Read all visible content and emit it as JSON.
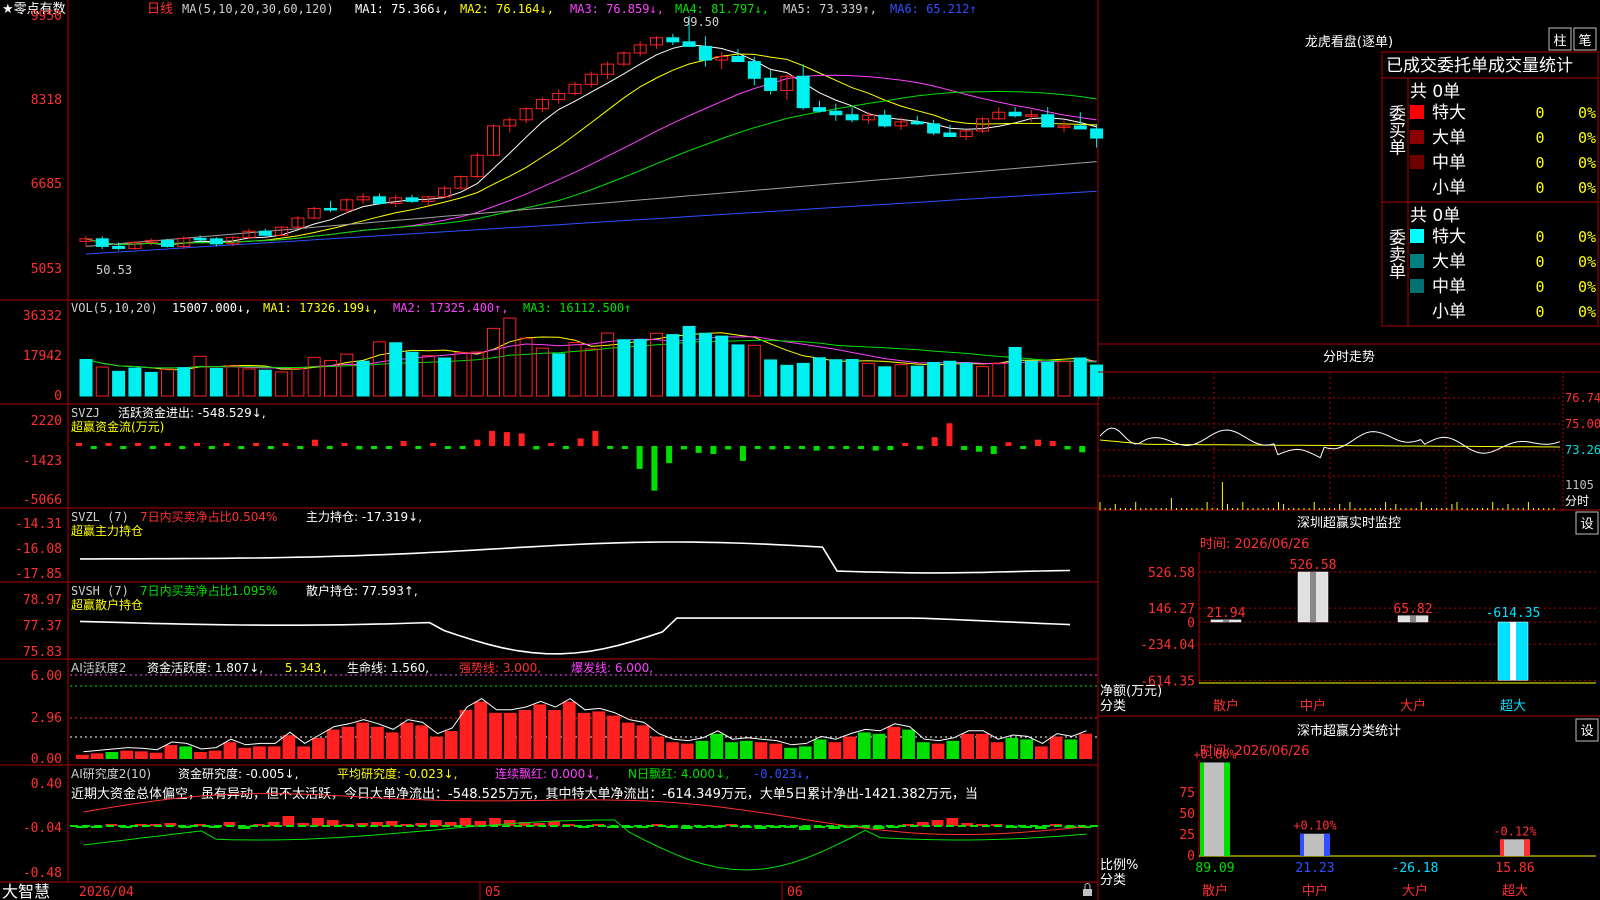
{
  "footer": {
    "brand": "大智慧",
    "start_date": "2026/04",
    "month_05": "05",
    "month_06": "06"
  },
  "colors": {
    "up": "#ff2020",
    "down": "#00f0f0",
    "green": "#00e000",
    "axis": "#b00000",
    "bg": "#000000"
  },
  "main": {
    "title_star": "★零点有数",
    "period": "日线",
    "ma_header": "MA(5,10,20,30,60,120)",
    "ma1": "MA1: 75.366↓,",
    "ma2": "MA2: 76.164↓,",
    "ma3": "MA3: 76.859↓,",
    "ma4": "MA4: 81.797↓,",
    "ma5": "MA5: 73.339↑,",
    "ma6": "MA6: 65.212↑",
    "yticks": [
      "9950",
      "8318",
      "6685",
      "5053"
    ],
    "high_label": "99.50",
    "low_label": "50.53"
  },
  "vol": {
    "header": "VOL(5,10,20)",
    "value": "15007.000↓,",
    "ma1": "MA1: 17326.199↓,",
    "ma2": "MA2: 17325.400↑,",
    "ma3": "MA3: 16112.500↑",
    "yticks": [
      "36332",
      "17942",
      "0"
    ]
  },
  "svzj": {
    "header": "SVZJ",
    "label": "活跃资金进出: -548.529↓,",
    "sub": "超赢资金流(万元)",
    "yticks": [
      "2220",
      "-1423",
      "-5066"
    ]
  },
  "svzl": {
    "header": "SVZL  (7)",
    "pct": "7日内买卖净占比0.504%",
    "label": "主力持仓: -17.319↓,",
    "sub": "超赢主力持仓",
    "yticks": [
      "-14.31",
      "-16.08",
      "-17.85"
    ]
  },
  "svsh": {
    "header": "SVSH  (7)",
    "pct": "7日内买卖净占比1.095%",
    "label": "散户持仓: 77.593↑,",
    "sub": "超赢散户持仓",
    "yticks": [
      "78.97",
      "77.37",
      "75.83"
    ]
  },
  "ai1": {
    "header": "AI活跃度2",
    "l1": "资金活跃度: 1.807↓,",
    "l2": "5.343,",
    "l3": "生命线: 1.560,",
    "l4": "强势线: 3.000,",
    "l5": "爆发线: 6.000,",
    "yticks": [
      "6.00",
      "2.96",
      "0.00"
    ]
  },
  "ai2": {
    "header": "AI研究度2(10)",
    "l1": "资金研究度: -0.005↓,",
    "l2": "平均研究度: -0.023↓,",
    "l3": "连续飘红: 0.000↓,",
    "l4": "N日飘红: 4.000↓,",
    "l5": "-0.023↓,",
    "text": "近期大资金总体偏空，虽有异动，但不太活跃，今日大单净流出：-548.525万元，其中特大单净流出：-614.349万元，大单5日累计净出-1421.382万元，当",
    "yticks": [
      "0.40",
      "-0.04",
      "-0.48"
    ]
  },
  "dragon": {
    "title": "龙虎看盘(逐单)",
    "btn_bar": "柱",
    "btn_pen": "笔",
    "header": "已成交委托单成交量统计",
    "buy_label": "委买单",
    "sell_label": "委卖单",
    "buy_total": "共 0单",
    "sell_total": "共 0单",
    "rows": [
      "特大",
      "大单",
      "中单",
      "小单"
    ],
    "count": "0",
    "pct": "0%"
  },
  "intraday": {
    "title": "分时走势",
    "yticks": [
      "76.74",
      "75.00",
      "73.26"
    ],
    "vol_tick": "1105",
    "vol_label": "分时"
  },
  "sz_monitor": {
    "title": "深圳超赢实时监控",
    "btn": "设",
    "time": "时间: 2026/06/26",
    "yticks": [
      "526.58",
      "146.27",
      "0",
      "-234.04",
      "-614.35"
    ],
    "ylabel": "净额(万元)",
    "xlabel": "分类"
  },
  "sz_class": {
    "title": "深市超赢分类统计",
    "btn": "设",
    "time": "时间: 2026/06/26",
    "yticks": [
      "75",
      "50",
      "25",
      "0"
    ],
    "ylabel": "比例%",
    "xlabel": "分类"
  },
  "chart_data": [
    {
      "type": "candlestick",
      "title": "零点有数 日线",
      "ylim": [
        50.53,
        99.5
      ],
      "ma_labels": [
        "MA1",
        "MA2",
        "MA3",
        "MA4",
        "MA5",
        "MA6"
      ],
      "ohlc": [
        [
          55,
          56,
          54,
          55.5
        ],
        [
          55.5,
          56,
          53.5,
          54
        ],
        [
          54,
          54.8,
          53.2,
          53.6
        ],
        [
          53.6,
          55,
          53.4,
          54.8
        ],
        [
          54.8,
          55.6,
          54.2,
          55.2
        ],
        [
          55.2,
          55.5,
          53.8,
          54
        ],
        [
          54,
          56,
          53.5,
          55.6
        ],
        [
          55.6,
          56.2,
          54.8,
          55.5
        ],
        [
          55.5,
          55.8,
          54,
          54.5
        ],
        [
          54.5,
          56,
          54,
          55.8
        ],
        [
          55.8,
          57.5,
          55.5,
          57
        ],
        [
          57,
          57.5,
          56,
          56.2
        ],
        [
          56.2,
          58,
          56,
          57.8
        ],
        [
          57.8,
          60,
          57.5,
          59.6
        ],
        [
          59.6,
          61.8,
          59.4,
          61.5
        ],
        [
          61.5,
          63,
          60.8,
          61.2
        ],
        [
          61.2,
          63.5,
          60.5,
          63.2
        ],
        [
          63.2,
          64.5,
          62.4,
          63.8
        ],
        [
          63.8,
          64.5,
          62.2,
          62.5
        ],
        [
          62.5,
          64.2,
          61.8,
          63.6
        ],
        [
          63.6,
          64.2,
          62.6,
          62.9
        ],
        [
          62.9,
          64,
          62,
          63.8
        ],
        [
          63.8,
          66,
          63.5,
          65.5
        ],
        [
          65.5,
          68,
          65.2,
          67.8
        ],
        [
          67.8,
          72.5,
          67.5,
          72
        ],
        [
          72,
          78,
          71.8,
          77.8
        ],
        [
          77.8,
          79.5,
          76.5,
          79
        ],
        [
          79,
          81.5,
          78.4,
          81.2
        ],
        [
          81.2,
          83.5,
          80.5,
          83
        ],
        [
          83,
          85,
          82.2,
          84.2
        ],
        [
          84.2,
          86.5,
          83.8,
          86
        ],
        [
          86,
          88.5,
          85.4,
          88
        ],
        [
          88,
          90.5,
          87,
          90
        ],
        [
          90,
          92.5,
          89.5,
          92.2
        ],
        [
          92.2,
          94.5,
          91.5,
          93.8
        ],
        [
          93.8,
          95.5,
          93,
          95.2
        ],
        [
          95.2,
          96,
          93.8,
          94.4
        ],
        [
          94.4,
          99.5,
          94,
          93.5
        ],
        [
          93.5,
          95.5,
          89.5,
          90.8
        ],
        [
          90.8,
          92.4,
          89,
          91.5
        ],
        [
          91.5,
          93,
          90.5,
          90.5
        ],
        [
          90.5,
          91.5,
          85.8,
          87.2
        ],
        [
          87.2,
          88.8,
          84,
          84.8
        ],
        [
          84.8,
          88,
          83,
          87.6
        ],
        [
          87.6,
          90,
          81,
          81.4
        ],
        [
          81.4,
          82.8,
          80.4,
          80.7
        ],
        [
          80.7,
          82.2,
          78.8,
          80
        ],
        [
          80,
          81.5,
          78.5,
          79
        ],
        [
          79,
          80.5,
          78.2,
          79.9
        ],
        [
          79.9,
          81,
          77.5,
          77.8
        ],
        [
          77.8,
          79.5,
          77,
          78.6
        ],
        [
          78.6,
          79.8,
          78,
          78.2
        ],
        [
          78.2,
          79,
          76,
          76.4
        ],
        [
          76.4,
          78,
          75.6,
          75.7
        ],
        [
          75.7,
          77,
          75,
          76.8
        ],
        [
          76.8,
          79.5,
          76.4,
          79.2
        ],
        [
          79.2,
          81.5,
          79,
          80.5
        ],
        [
          80.5,
          81.5,
          79.5,
          79.8
        ],
        [
          79.8,
          81,
          78.6,
          80
        ],
        [
          80,
          81.5,
          77.5,
          77.6
        ],
        [
          77.6,
          78.8,
          76.5,
          77.8
        ],
        [
          77.8,
          80.5,
          77.5,
          77.2
        ],
        [
          77.2,
          78.2,
          73.5,
          75.4
        ]
      ]
    },
    {
      "type": "bar",
      "title": "VOL(5,10,20)",
      "ylim": [
        0,
        36332
      ],
      "values": [
        17000,
        13500,
        11500,
        13000,
        11000,
        12500,
        13200,
        18500,
        12800,
        14000,
        12600,
        12000,
        11200,
        12800,
        18000,
        16500,
        19500,
        16200,
        25200,
        24800,
        20400,
        18800,
        17700,
        20300,
        20500,
        31500,
        36300,
        26900,
        22300,
        19600,
        24900,
        21900,
        29300,
        26200,
        26300,
        29200,
        28600,
        32400,
        29200,
        27900,
        23800,
        23600,
        16800,
        14300,
        15200,
        17800,
        16900,
        17000,
        15200,
        13600,
        14600,
        13900,
        15600,
        16200,
        15300,
        13700,
        15300,
        22600,
        16200,
        15800,
        16000,
        17700,
        14400
      ],
      "up": [
        false,
        true,
        false,
        false,
        false,
        true,
        false,
        true,
        false,
        true,
        true,
        false,
        true,
        true,
        true,
        true,
        true,
        false,
        true,
        false,
        false,
        true,
        false,
        true,
        true,
        true,
        true,
        true,
        true,
        false,
        true,
        true,
        true,
        false,
        false,
        true,
        false,
        false,
        false,
        false,
        false,
        true,
        false,
        false,
        false,
        false,
        false,
        false,
        true,
        false,
        true,
        false,
        false,
        false,
        false,
        true,
        true,
        false,
        false,
        false,
        true,
        false,
        false
      ]
    },
    {
      "type": "bar",
      "title": "SVZJ 活跃资金进出",
      "ylim": [
        -5066,
        2220
      ],
      "values": [
        150,
        -80,
        120,
        -60,
        90,
        -70,
        40,
        -60,
        30,
        -40,
        80,
        -100,
        110,
        -50,
        60,
        -90,
        500,
        -80,
        120,
        -300,
        -200,
        -150,
        400,
        -120,
        80,
        -90,
        -150,
        500,
        1200,
        1100,
        1000,
        -300,
        200,
        -150,
        600,
        1200,
        -180,
        -130,
        -2000,
        -3900,
        -1500,
        -300,
        -600,
        -700,
        -300,
        -1300,
        -250,
        -300,
        -180,
        -250,
        -400,
        -150,
        -100,
        -260,
        -400,
        -350,
        200,
        -300,
        700,
        1800,
        -350,
        -500,
        -700,
        300,
        -150,
        500,
        400,
        -300,
        -548.5
      ]
    },
    {
      "type": "line",
      "title": "SVZL 主力持仓",
      "ylim": [
        -17.85,
        -14.31
      ]
    },
    {
      "type": "line",
      "title": "SVSH 散户持仓",
      "ylim": [
        75.83,
        78.97
      ]
    },
    {
      "type": "bar",
      "title": "AI活跃度2 资金活跃度",
      "ylim": [
        0,
        6
      ],
      "reference_lines": {
        "生命线": 1.56,
        "强势线": 3.0,
        "爆发线": 6.0
      },
      "values": [
        0.3,
        0.4,
        0.5,
        0.6,
        0.55,
        0.45,
        1.0,
        0.9,
        0.5,
        0.6,
        1.2,
        0.8,
        0.9,
        0.9,
        1.7,
        0.9,
        1.5,
        2.1,
        2.3,
        2.6,
        2.3,
        1.9,
        2.6,
        2.4,
        1.6,
        2.0,
        3.5,
        4.1,
        3.3,
        3.3,
        3.5,
        3.9,
        3.5,
        4.1,
        3.3,
        3.4,
        3.1,
        2.6,
        2.4,
        1.6,
        1.2,
        1.1,
        1.3,
        1.8,
        1.2,
        1.3,
        1.2,
        1.1,
        0.8,
        0.9,
        1.4,
        1.2,
        1.6,
        1.9,
        1.8,
        2.3,
        2.1,
        1.2,
        1.1,
        1.3,
        1.8,
        1.8,
        1.2,
        1.5,
        1.4,
        0.9,
        1.6,
        1.4,
        1.807
      ],
      "up": [
        true,
        true,
        false,
        true,
        true,
        true,
        true,
        false,
        true,
        true,
        true,
        true,
        true,
        true,
        true,
        true,
        true,
        true,
        true,
        true,
        true,
        true,
        true,
        true,
        true,
        true,
        true,
        true,
        true,
        true,
        true,
        true,
        true,
        true,
        true,
        true,
        true,
        true,
        true,
        true,
        true,
        true,
        false,
        false,
        false,
        false,
        true,
        true,
        false,
        false,
        false,
        true,
        true,
        false,
        false,
        true,
        false,
        false,
        true,
        false,
        true,
        true,
        true,
        false,
        false,
        true,
        true,
        false,
        true
      ]
    },
    {
      "type": "bar",
      "title": "AI研究度2(10)",
      "ylim": [
        -0.48,
        0.4
      ],
      "values": [
        -0.01,
        -0.02,
        0.01,
        -0.01,
        0.02,
        0.0,
        0.03,
        -0.01,
        0.01,
        -0.02,
        0.04,
        -0.03,
        0.02,
        0.04,
        0.1,
        0.03,
        0.08,
        0.06,
        0.01,
        0.03,
        0.04,
        0.05,
        0.02,
        0.03,
        0.06,
        0.04,
        0.08,
        0.05,
        0.08,
        0.06,
        0.04,
        0.03,
        0.05,
        0.02,
        -0.01,
        0.0,
        -0.01,
        -0.02,
        -0.01,
        0.0,
        -0.02,
        -0.03,
        -0.01,
        -0.01,
        0.0,
        -0.02,
        -0.03,
        -0.01,
        -0.02,
        -0.04,
        -0.02,
        -0.03,
        -0.01,
        -0.02,
        -0.03,
        -0.01,
        0.02,
        0.04,
        0.06,
        0.08,
        0.03,
        0.02,
        0.01,
        -0.01,
        -0.02,
        -0.03,
        0.02,
        -0.01,
        -0.005
      ]
    },
    {
      "type": "bar",
      "title": "深圳超赢实时监控",
      "categories": [
        "散户",
        "中户",
        "大户",
        "超大"
      ],
      "values": [
        21.94,
        526.58,
        65.82,
        -614.35
      ],
      "ylabel": "净额(万元)",
      "xlabel": "分类"
    },
    {
      "type": "bar",
      "title": "深市超赢分类统计",
      "categories": [
        "散户",
        "中户",
        "大户",
        "超大"
      ],
      "values": [
        89.09,
        21.23,
        -26.18,
        15.86
      ],
      "top_labels": [
        "+0.00%",
        "+0.10%",
        "",
        "-0.12%"
      ],
      "ylabel": "比例%",
      "xlabel": "分类"
    }
  ]
}
